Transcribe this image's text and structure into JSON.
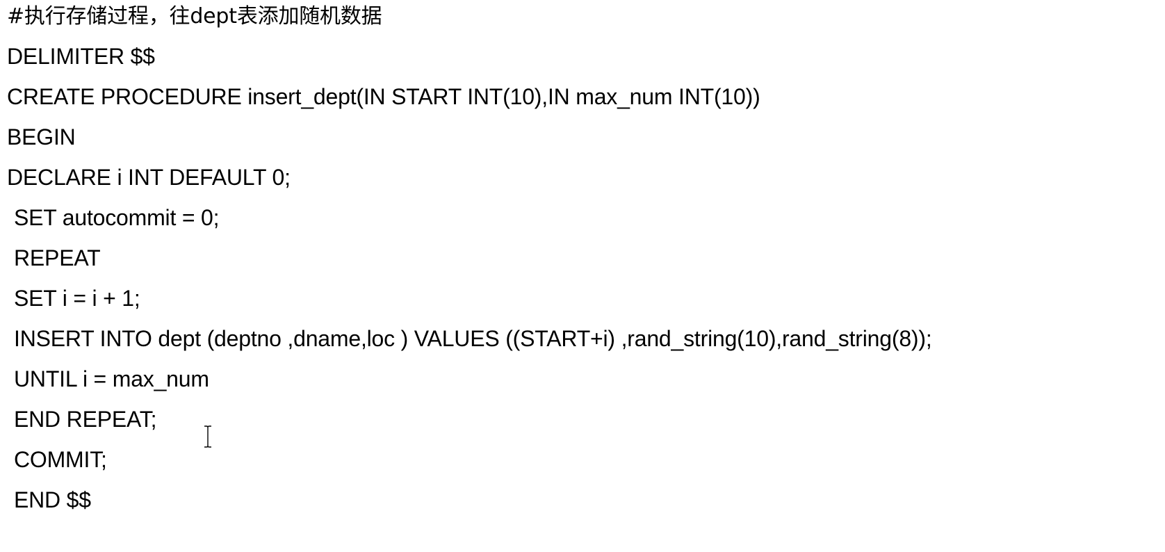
{
  "code_lines": [
    "#执行存储过程，往dept表添加随机数据",
    "DELIMITER $$",
    "CREATE PROCEDURE insert_dept(IN START INT(10),IN max_num INT(10))",
    "BEGIN",
    "DECLARE i INT DEFAULT 0;",
    "SET autocommit = 0;",
    "REPEAT",
    "SET i = i + 1;",
    "INSERT INTO dept (deptno ,dname,loc ) VALUES ((START+i) ,rand_string(10),rand_string(8));",
    "UNTIL i = max_num",
    "END REPEAT;",
    "COMMIT;",
    "END $$"
  ],
  "cursor": {
    "icon": "text-ibeam-cursor-icon"
  },
  "colors": {
    "background": "#ffffff",
    "text": "#000000"
  }
}
